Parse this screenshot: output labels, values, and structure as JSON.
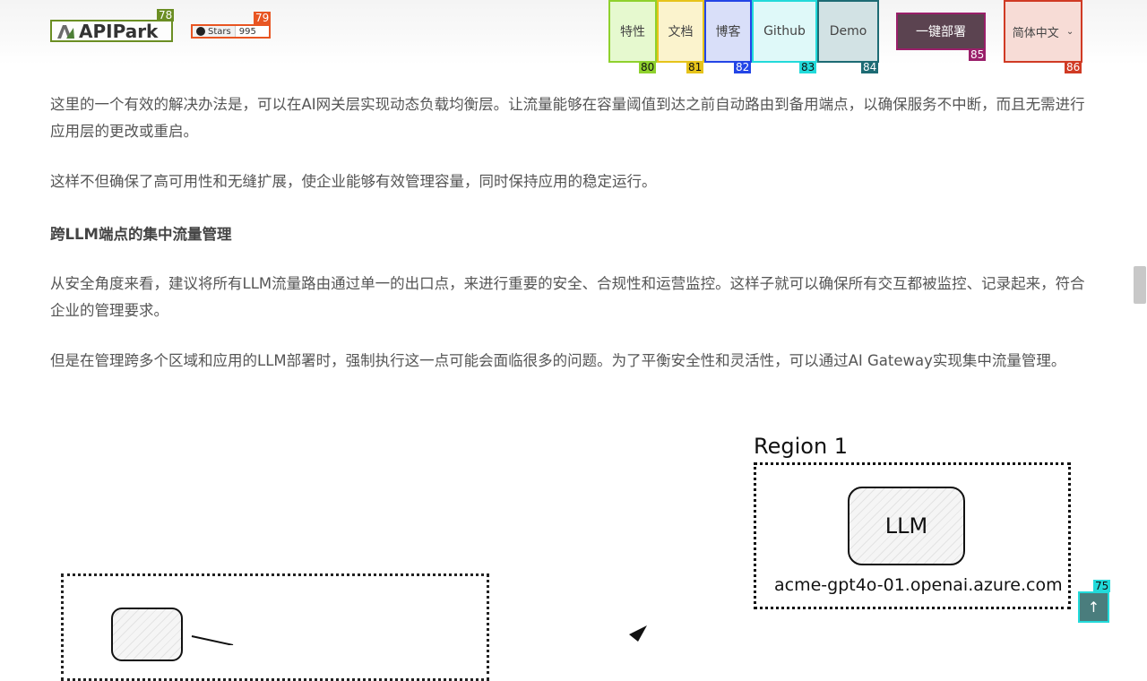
{
  "header": {
    "logo_text": "APIPark",
    "github": {
      "label": "Stars",
      "count": "995"
    },
    "nav": [
      {
        "label": "特性",
        "marker": "80"
      },
      {
        "label": "文档",
        "marker": "81"
      },
      {
        "label": "博客",
        "marker": "82"
      },
      {
        "label": "Github",
        "marker": "83"
      },
      {
        "label": "Demo",
        "marker": "84"
      }
    ],
    "deploy_label": "一键部署",
    "language_label": "简体中文",
    "markers": {
      "logo": "78",
      "stars": "79",
      "deploy": "85",
      "language": "86",
      "back_top": "75"
    },
    "colors": {
      "logo": "#6b8e23",
      "stars": "#e85522",
      "nav": [
        "#8fd12d",
        "#e6c31a",
        "#2345e6",
        "#22dada",
        "#1d6b74"
      ],
      "deploy": "#9a1f6a",
      "language": "#d03a24",
      "back_top": "#22dada"
    }
  },
  "article": {
    "paragraphs": [
      "这里的一个有效的解决办法是，可以在AI网关层实现动态负载均衡层。让流量能够在容量阈值到达之前自动路由到备用端点，以确保服务不中断，而且无需进行应用层的更改或重启。",
      "这样不但确保了高可用性和无缝扩展，使企业能够有效管理容量，同时保持应用的稳定运行。"
    ],
    "heading": "跨LLM端点的集中流量管理",
    "paragraphs2": [
      "从安全角度来看，建议将所有LLM流量路由通过单一的出口点，来进行重要的安全、合规性和运营监控。这样子就可以确保所有交互都被监控、记录起来，符合企业的管理要求。",
      "但是在管理跨多个区域和应用的LLM部署时，强制执行这一点可能会面临很多的问题。为了平衡安全性和灵活性，可以通过AI Gateway实现集中流量管理。"
    ]
  },
  "diagram": {
    "region_title": "Region 1",
    "llm_label": "LLM",
    "endpoint": "acme-gpt4o-01.openai.azure.com"
  },
  "back_top_icon": "arrow-up-icon"
}
